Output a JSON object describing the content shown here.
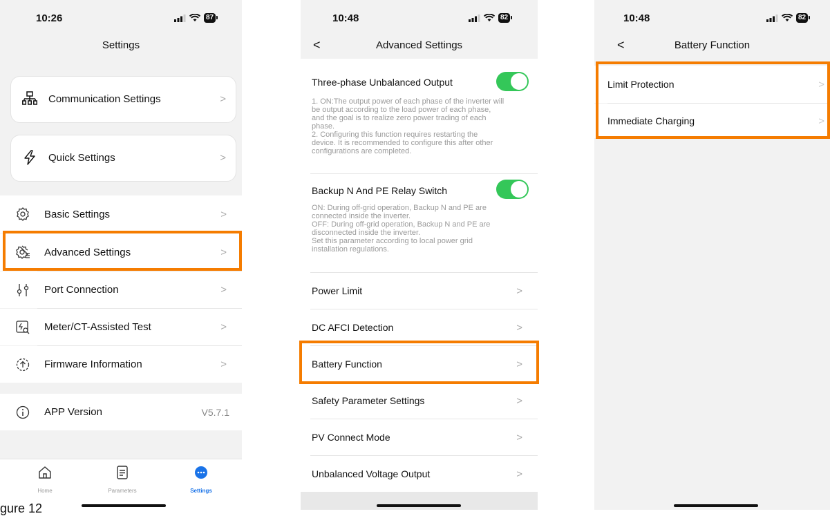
{
  "screen1": {
    "status": {
      "time": "10:26",
      "battery": "87"
    },
    "title": "Settings",
    "cards": [
      {
        "label": "Communication Settings",
        "icon": "network-icon"
      },
      {
        "label": "Quick Settings",
        "icon": "lightning-icon"
      }
    ],
    "items": [
      {
        "label": "Basic Settings"
      },
      {
        "label": "Advanced Settings"
      },
      {
        "label": "Port Connection"
      },
      {
        "label": "Meter/CT-Assisted Test"
      },
      {
        "label": "Firmware Information"
      }
    ],
    "app_version": {
      "label": "APP Version",
      "value": "V5.7.1"
    },
    "tabs": [
      {
        "label": "Home"
      },
      {
        "label": "Parameters"
      },
      {
        "label": "Settings",
        "active": true
      }
    ],
    "caption": "gure 12"
  },
  "screen2": {
    "status": {
      "time": "10:48",
      "battery": "82"
    },
    "title": "Advanced Settings",
    "toggles": [
      {
        "label": "Three-phase Unbalanced Output",
        "on": true,
        "desc": [
          "1. ON:The output power of each phase of the inverter will",
          "be output according to the load power of each phase,",
          "and the goal is to realize zero power trading of each",
          "phase.",
          "2. Configuring this function requires restarting the",
          "device. It is recommended to configure this after other",
          "configurations are completed."
        ]
      },
      {
        "label": "Backup N And PE Relay Switch",
        "on": true,
        "desc": [
          "ON: During off-grid operation, Backup N and PE are",
          "connected inside the inverter.",
          "OFF: During off-grid operation, Backup N and PE are",
          "disconnected inside the inverter.",
          "Set this parameter according to local power grid",
          "installation regulations."
        ]
      }
    ],
    "items": [
      {
        "label": "Power Limit"
      },
      {
        "label": "DC AFCI Detection"
      },
      {
        "label": "Battery Function"
      },
      {
        "label": "Safety Parameter Settings"
      },
      {
        "label": "PV Connect Mode"
      },
      {
        "label": "Unbalanced Voltage Output"
      }
    ]
  },
  "screen3": {
    "status": {
      "time": "10:48",
      "battery": "82"
    },
    "title": "Battery Function",
    "items": [
      {
        "label": "Limit Protection"
      },
      {
        "label": "Immediate Charging"
      }
    ]
  },
  "colors": {
    "highlight": "#f57c00",
    "toggle_on": "#34c759",
    "tab_active": "#1a73e8"
  }
}
